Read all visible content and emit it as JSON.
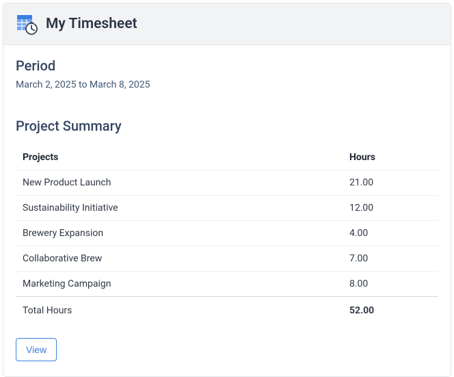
{
  "header": {
    "title": "My Timesheet",
    "icon": "timesheet-icon"
  },
  "period": {
    "label": "Period",
    "value": "March 2, 2025 to March 8, 2025"
  },
  "summary": {
    "title": "Project Summary",
    "columns": {
      "project": "Projects",
      "hours": "Hours"
    },
    "rows": [
      {
        "project": "New Product Launch",
        "hours": "21.00"
      },
      {
        "project": "Sustainability Initiative",
        "hours": "12.00"
      },
      {
        "project": "Brewery Expansion",
        "hours": "4.00"
      },
      {
        "project": "Collaborative Brew",
        "hours": "7.00"
      },
      {
        "project": "Marketing Campaign",
        "hours": "8.00"
      }
    ],
    "total": {
      "label": "Total Hours",
      "value": "52.00"
    }
  },
  "actions": {
    "view": "View"
  }
}
